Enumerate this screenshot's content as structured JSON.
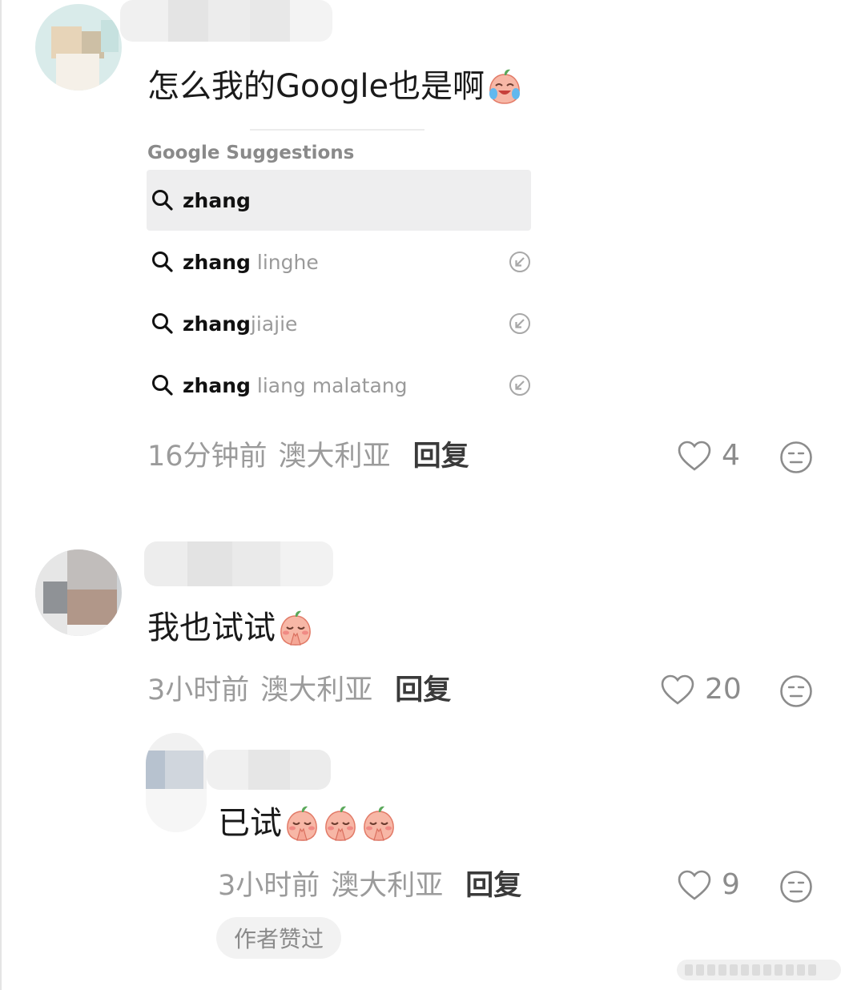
{
  "comments": [
    {
      "text": "怎么我的Google也是啊",
      "time": "16分钟前",
      "location": "澳大利亚",
      "reply_label": "回复",
      "likes": "4",
      "emoji": "laughing-crying-peach"
    },
    {
      "text": "我也试试",
      "time": "3小时前",
      "location": "澳大利亚",
      "reply_label": "回复",
      "likes": "20",
      "emoji": "praying-peach"
    }
  ],
  "reply": {
    "text": "已试",
    "time": "3小时前",
    "location": "澳大利亚",
    "reply_label": "回复",
    "likes": "9",
    "emoji": "praying-peach",
    "emoji_count": 3,
    "author_badge": "作者赞过"
  },
  "google_suggestions": {
    "title": "Google Suggestions",
    "items": [
      {
        "bold": "zhang",
        "rest": "",
        "selected": true
      },
      {
        "bold": "zhang",
        "rest": " linghe",
        "selected": false
      },
      {
        "bold": "zhang",
        "rest": "jiajie",
        "selected": false
      },
      {
        "bold": "zhang",
        "rest": " liang malatang",
        "selected": false
      }
    ]
  },
  "colors": {
    "muted_text": "#9b9b9b",
    "reply_text": "#3a3a3a",
    "selected_row": "#eeeeef",
    "badge_bg": "#f2f2f2"
  }
}
